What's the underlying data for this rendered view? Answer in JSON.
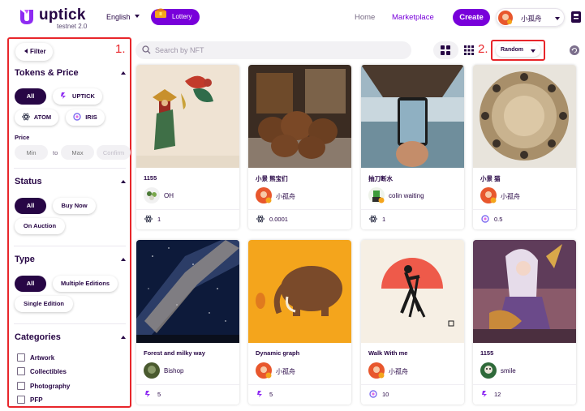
{
  "header": {
    "logo_text": "uptick",
    "logo_sub": "testnet 2.0",
    "language": "English",
    "lottery_label": "Lottery",
    "nav": {
      "home": "Home",
      "marketplace": "Marketplace"
    },
    "create_label": "Create",
    "user_name": "小孤舟"
  },
  "sidebar": {
    "filter_label": "Filter",
    "tokens_title": "Tokens & Price",
    "tokens": [
      {
        "label": "All",
        "active": true
      },
      {
        "label": "UPTICK",
        "icon": "uptick-icon"
      },
      {
        "label": "ATOM",
        "icon": "atom-icon"
      },
      {
        "label": "IRIS",
        "icon": "iris-icon"
      }
    ],
    "price_label": "Price",
    "price_min_placeholder": "Min",
    "price_to": "to",
    "price_max_placeholder": "Max",
    "confirm_label": "Confirm",
    "status_title": "Status",
    "status": [
      {
        "label": "All",
        "active": true
      },
      {
        "label": "Buy Now"
      },
      {
        "label": "On Auction"
      }
    ],
    "type_title": "Type",
    "types": [
      {
        "label": "All",
        "active": true
      },
      {
        "label": "Multiple Editions"
      },
      {
        "label": "Single Edition"
      }
    ],
    "categories_title": "Categories",
    "categories": [
      "Artwork",
      "Collectibles",
      "Photography",
      "PFP"
    ]
  },
  "annotations": {
    "one": "1.",
    "two": "2."
  },
  "toolbar": {
    "search_placeholder": "Search by NFT",
    "sort_value": "Random"
  },
  "cards": [
    {
      "title": "1155",
      "owner": "OH",
      "price": "1",
      "coin": "atom-icon",
      "image": "shadow-puppet-art"
    },
    {
      "title": "小景 熊宝们",
      "owner": "小孤舟",
      "price": "0.0001",
      "coin": "atom-icon",
      "image": "plush-bears-photo"
    },
    {
      "title": "抽刀断水",
      "owner": "colin waiting",
      "price": "1",
      "coin": "atom-icon",
      "image": "phone-under-pier-photo"
    },
    {
      "title": "小景 猫",
      "owner": "小孤舟",
      "price": "0.5",
      "coin": "iris-icon",
      "image": "cats-plate-art"
    },
    {
      "title": "Forest and milky way",
      "owner": "Bishop",
      "price": "5",
      "coin": "uptick-icon",
      "image": "milky-way-photo"
    },
    {
      "title": "Dynamic graph",
      "owner": "小孤舟",
      "price": "5",
      "coin": "uptick-icon",
      "image": "mammoth-illustration"
    },
    {
      "title": "Walk With me",
      "owner": "小孤舟",
      "price": "10",
      "coin": "iris-icon",
      "image": "walking-figures-illustration"
    },
    {
      "title": "1155",
      "owner": "smile",
      "price": "12",
      "coin": "uptick-icon",
      "image": "anime-warrior-art"
    }
  ],
  "colors": {
    "brand": "#7800da",
    "text": "#270645",
    "annotation": "#e8262b"
  }
}
